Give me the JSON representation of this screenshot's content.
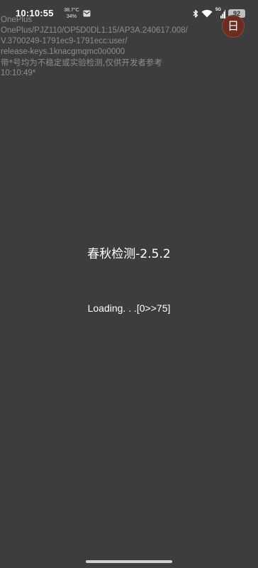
{
  "status_bar": {
    "time": "10:10:55",
    "temperature": "38.7°C",
    "humidity": "34%",
    "network": "5G",
    "battery": "92",
    "icons": [
      "mail-icon",
      "bluetooth-icon",
      "wifi-icon",
      "signal-icon",
      "battery-icon"
    ]
  },
  "avatar": {
    "glyph": "日丰"
  },
  "device_info": {
    "lines": [
      "OnePlus",
      "OnePlus/PJZ110/OP5D0DL1:15/AP3A.240617.008/",
      "V.3700249-1791ec9-1791ecc:user/",
      "release-keys.1knacgmqmc0o0000",
      "带*号均为不稳定或实验检测,仅供开发者参考",
      "10:10:49*"
    ]
  },
  "app": {
    "title": "春秋检测-2.5.2",
    "loading": "Loading. . .[0>>75]"
  },
  "colors": {
    "background": "#3d3d3d",
    "overlay_text": "#8e8e8e",
    "avatar": "#6b2d1f"
  }
}
